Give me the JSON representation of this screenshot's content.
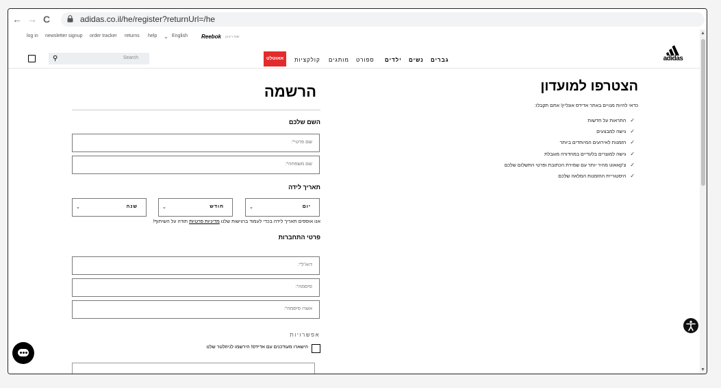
{
  "browser": {
    "back": "←",
    "forward": "→",
    "reload": "C",
    "url": "adidas.co.il/he/register?returnUrl=/he"
  },
  "utility_nav": {
    "items": [
      "log in",
      "newsletter signup",
      "order tracker",
      "returns",
      "help",
      "English"
    ],
    "reebok": "Reebok",
    "reebok_sub": "שופ ריבוק"
  },
  "header": {
    "search_placeholder": "Search",
    "outlet": "אאוטלט",
    "categories": [
      "גברים",
      "נשים",
      "ילדים",
      "ספורט",
      "מותגים",
      "קולקציות"
    ],
    "logo": "adidas"
  },
  "club": {
    "title": "הצטרפו למועדון",
    "intro": "כדאי להיות מנויים באתר אדידס אונליין! אתם תקבלו:",
    "benefits": [
      "התראות על חדשות",
      "גישה למבצעים",
      "הזמנות לאירועים המיוחדים ביותר",
      "גישה למוצרים בלעדיים במהדורה מוגבלת",
      "צ'קאאוט מהיר יותר עם שמירת הכתובת ופרטי התשלום שלכם",
      "היסטוריית ההזמנות המלאה שלכם"
    ]
  },
  "register": {
    "title": "הרשמה",
    "name_section": "השם שלכם",
    "first_name_placeholder": "שם פרטי*:",
    "last_name_placeholder": "שם משפחה*:",
    "dob_section": "תאריך לידה",
    "day": "יום",
    "month": "חודש",
    "year": "שנה",
    "privacy_text": "אנו אוספים תאריך לידה בכדי לעמוד ברגישות שלנו",
    "privacy_link": "מדיניות פרטיות",
    "privacy_suffix": "תודה על השיתוף!",
    "login_section": "פרטי התחברות",
    "email_placeholder": "דוא\"ל*:",
    "password_placeholder": "סיסמה*:",
    "confirm_password_placeholder": "אשרו סיסמה*:",
    "options_title": "אפשרויות",
    "newsletter_label": "הישארו מעודכנים עם אדידס! הירשמו לניוזלטר שלנו"
  },
  "icons": {
    "checkmark": "✓",
    "chevron": "⌄"
  }
}
